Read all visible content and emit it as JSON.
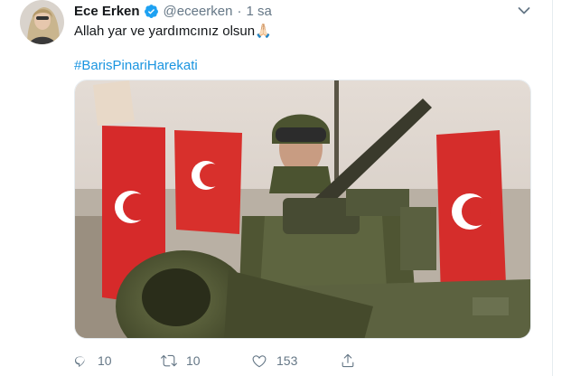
{
  "tweet": {
    "author_name": "Ece Erken",
    "handle": "@eceerken",
    "separator": "·",
    "time": "1 sa",
    "text": "Allah yar ve yardımcınız olsun",
    "emoji": "🙏🏻",
    "hashtag": "#BarisPinariHarekati"
  },
  "actions": {
    "reply_count": "10",
    "retweet_count": "10",
    "like_count": "153"
  },
  "colors": {
    "link": "#1b95e0",
    "muted": "#657786",
    "text": "#14171a",
    "verified": "#1da1f2"
  },
  "icons": [
    "avatar",
    "verified-badge-icon",
    "chevron-down-icon",
    "reply-icon",
    "retweet-icon",
    "like-icon",
    "share-icon"
  ]
}
